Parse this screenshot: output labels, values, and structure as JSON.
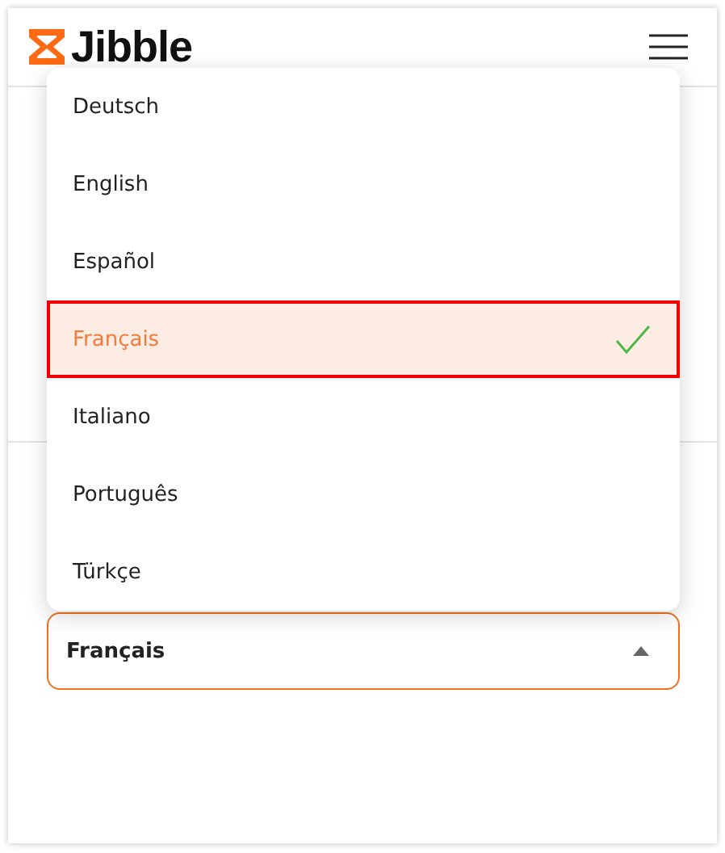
{
  "header": {
    "logo_text": "Jibble"
  },
  "language_menu": {
    "items": [
      {
        "label": "Deutsch",
        "selected": false
      },
      {
        "label": "English",
        "selected": false
      },
      {
        "label": "Español",
        "selected": false
      },
      {
        "label": "Français",
        "selected": true
      },
      {
        "label": "Italiano",
        "selected": false
      },
      {
        "label": "Português",
        "selected": false
      },
      {
        "label": "Türkçe",
        "selected": false
      }
    ]
  },
  "language_select": {
    "value": "Français",
    "expanded": true
  }
}
